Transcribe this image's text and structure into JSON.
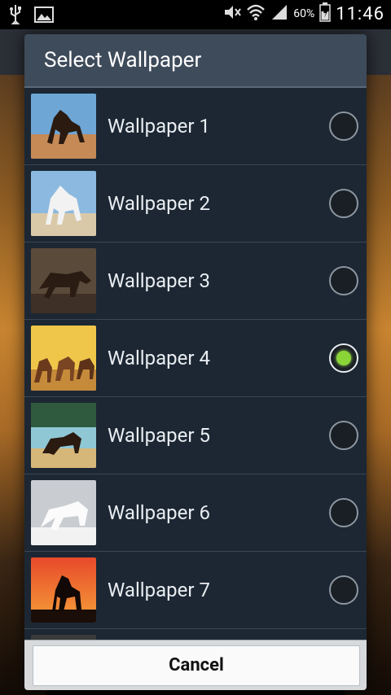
{
  "status_bar": {
    "time": "11:46",
    "battery_percent": "60%",
    "icons": [
      "usb-icon",
      "image-icon",
      "mute-icon",
      "wifi-icon",
      "signal-icon",
      "battery-icon"
    ]
  },
  "dialog": {
    "title": "Select Wallpaper",
    "items": [
      {
        "label": "Wallpaper 1",
        "selected": false
      },
      {
        "label": "Wallpaper 2",
        "selected": false
      },
      {
        "label": "Wallpaper 3",
        "selected": false
      },
      {
        "label": "Wallpaper 4",
        "selected": true
      },
      {
        "label": "Wallpaper 5",
        "selected": false
      },
      {
        "label": "Wallpaper 6",
        "selected": false
      },
      {
        "label": "Wallpaper 7",
        "selected": false
      }
    ],
    "cancel_label": "Cancel"
  },
  "colors": {
    "dialog_bg": "#1c2733",
    "title_bg": "#3e4b5a",
    "radio_selected": "#8bd438"
  }
}
